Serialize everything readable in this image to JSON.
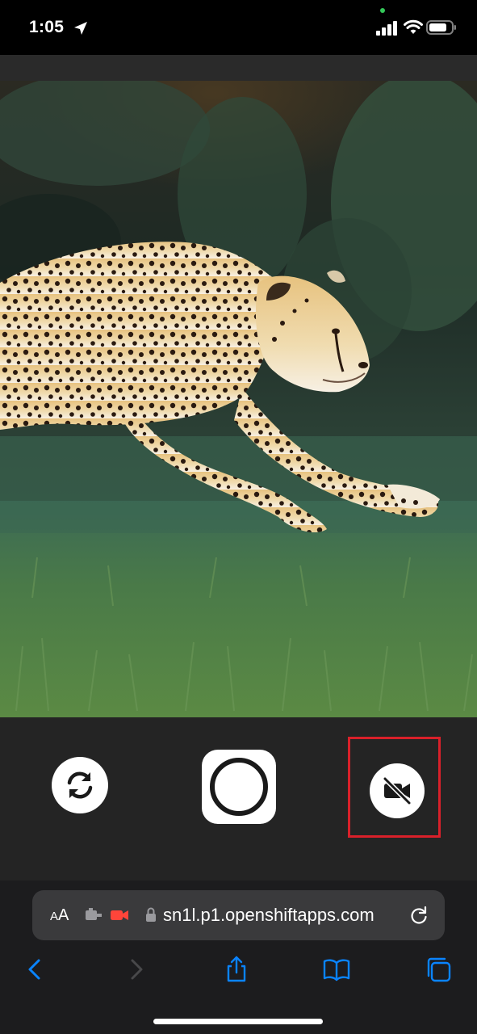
{
  "status_bar": {
    "time": "1:05",
    "icons": [
      "location-arrow-icon",
      "cellular-signal-icon",
      "wifi-icon",
      "battery-icon"
    ],
    "privacy_dot_color": "#34c759"
  },
  "camera": {
    "preview_subject": "cheetah-running-on-grass",
    "controls": {
      "switch_camera_icon": "camera-switch-icon",
      "shutter_icon": "shutter-ring-icon",
      "camera_off_icon": "video-slash-icon"
    },
    "highlight_color": "#d9202a"
  },
  "browser": {
    "text_size_label_small": "A",
    "text_size_label_large": "A",
    "url": "sn1l.p1.openshiftapps.com",
    "camera_indicator_color": "#ff453a",
    "accent_color": "#0a84ff",
    "toolbar_icons": [
      "back-icon",
      "forward-icon",
      "share-icon",
      "bookmarks-icon",
      "tabs-icon"
    ]
  }
}
